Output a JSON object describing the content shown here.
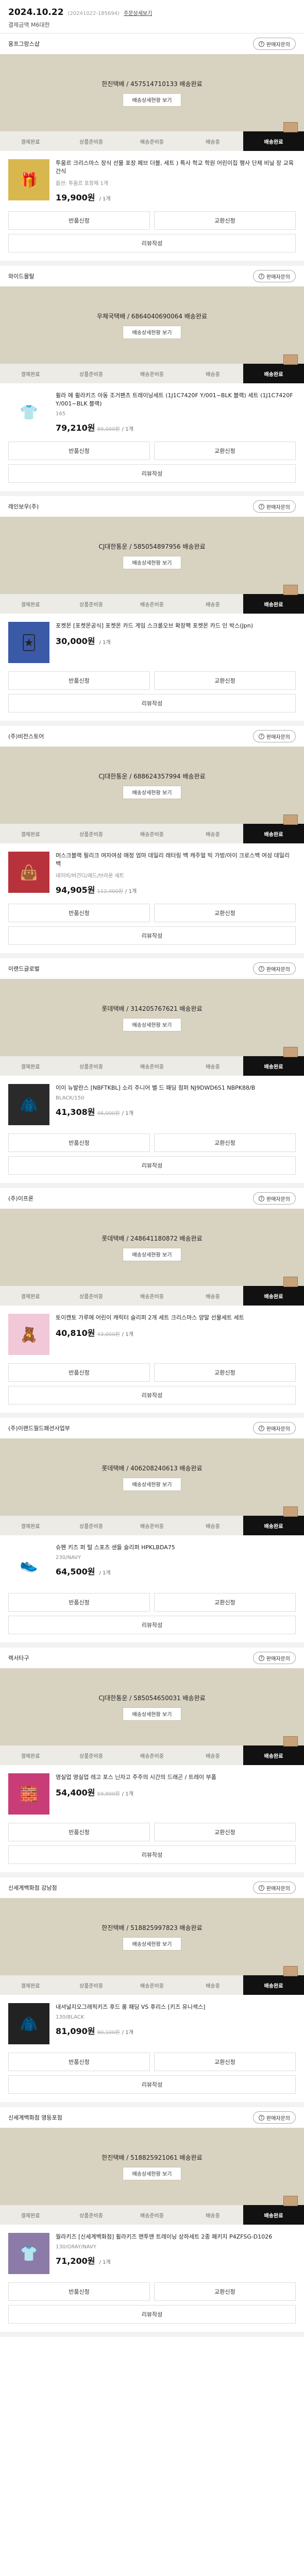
{
  "header": {
    "date": "2024.10.22",
    "order_no": "(20241022-185694)",
    "detail_link": "주문상세보기",
    "member_line": "결제금액 M6대한"
  },
  "steps": [
    "결제완료",
    "상품준비중",
    "배송준비중",
    "배송중",
    "배송완료"
  ],
  "active_step": 4,
  "inquiry_label": "판매자문의",
  "tracking_button_label": "배송상세현황 보기",
  "actions": {
    "exchange": "교환신청",
    "return": "반품신청",
    "review": "리뷰작성"
  },
  "orders": [
    {
      "seller": "옹프그랑스샵",
      "tracking": "한진택배 / 457514710133 배송완료",
      "product_name": "투움르 크리스마스 장식 선물 포장 페브 더블, 세트 ) 특사 학교 학원 어린이집 행사 단체 비닐 장 교육 간식",
      "option": "옵션: 투움르 포장제 1개",
      "price": "19,900원",
      "orig_price": "",
      "qty": "/ 1개",
      "img_color": "#d8b84e",
      "icon": "🎁"
    },
    {
      "seller": "와이드몰탈",
      "tracking": "우체국택배 / 6864040690064 배송완료",
      "product_name": "휠라 에 휠라키즈 아동 조거팬츠 트레이닝세트 (1J1C7420F Y/001~BLK 블랙) 세트 (1J1C7420F Y/001~BLK 블랙)",
      "option": "165",
      "price": "79,210원",
      "orig_price": "89,000원",
      "qty": "/ 1개",
      "img_color": "#ffffff",
      "icon": "👕"
    },
    {
      "seller": "레인보우(주)",
      "tracking": "CJ대한통운 / 585054897956 배송완료",
      "product_name": "포켓몬 [포켓몬공식] 포켓몬 카드 게임 스크롤오브 확장팩 포켓몬 카드 인 박스(Jpn)",
      "option": "",
      "price": "30,000원",
      "orig_price": "",
      "qty": "/ 1개",
      "img_color": "#3a5aa8",
      "icon": "🃏"
    },
    {
      "seller": "(주)비전스토어",
      "tracking": "CJ대한통운 / 688624357994 배송완료",
      "product_name": "머스크블랙 필리크 여자여성 애정 엄마 데일리 레터링 백 캐주얼 빅 가방/아이 크로스백 여성 데일리 백",
      "option": "네이비/버건디/레드/브라운 세트",
      "price": "94,905원",
      "orig_price": "112,000원",
      "qty": "/ 1개",
      "img_color": "#b8323c",
      "icon": "👜"
    },
    {
      "seller": "이랜드글로벌",
      "tracking": "롯데택배 / 314205767621 배송완료",
      "product_name": "이이 뉴발란스 [NBFTKBL] 소리 주니어 벨 드 패딩 점퍼 NJ9DWD6S1 NBPK88/B",
      "option": "BLACK/150",
      "price": "41,308원",
      "orig_price": "46,000원",
      "qty": "/ 1개",
      "img_color": "#2a2a2a",
      "icon": "🧥"
    },
    {
      "seller": "(주)이프론",
      "tracking": "롯데택배 / 248641180872 배송완료",
      "product_name": "토이캔토 가루에 어린이 캐릭터 슬리퍼 2개 세트 크리스마스 양말 선물세트 세트",
      "option": "",
      "price": "40,810원",
      "orig_price": "43,000원",
      "qty": "/ 1개",
      "img_color": "#f0c8d8",
      "icon": "🧸"
    },
    {
      "seller": "(주)이랜드월드패션사업부",
      "tracking": "롯데택배 / 406208240613 배송완료",
      "product_name": "슈펜 키즈 퍼 털 스포츠 샌들 슬리퍼 HPKLBDA75",
      "option": "230/NAVY",
      "price": "64,500원",
      "orig_price": "",
      "qty": "/ 1개",
      "img_color": "#ffffff",
      "icon": "👟"
    },
    {
      "seller": "렉서타구",
      "tracking": "CJ대한통운 / 585054650031 배송완료",
      "product_name": "영실업 영실업 레고 포스 닌자고 주주의 시간의 드래곤 / 트레이 부품",
      "option": "",
      "price": "54,400원",
      "orig_price": "59,900원",
      "qty": "/ 1개",
      "img_color": "#c83c78",
      "icon": "🧱"
    },
    {
      "seller": "신세계백화점 강남점",
      "tracking": "한진택배 / 518825997823 배송완료",
      "product_name": "내셔널지오그래픽키즈 후드 롱 패딩 VS 후리스 [키즈 유니섹스]",
      "option": "130/BLACK",
      "price": "81,090원",
      "orig_price": "90,100원",
      "qty": "/ 1개",
      "img_color": "#222222",
      "icon": "🧥"
    },
    {
      "seller": "신세계백화점 영등포점",
      "tracking": "한진택배 / 518825921061 배송완료",
      "product_name": "월라키즈 [신세계백화점] 휠라키즈 맨투맨 트레이닝 상하세트 2종 패키지 P4ZFSG-D1026",
      "option": "130/GRAY/NAVY",
      "price": "71,200원",
      "orig_price": "",
      "qty": "/ 1개",
      "img_color": "#8c7aa8",
      "icon": "👕"
    }
  ]
}
